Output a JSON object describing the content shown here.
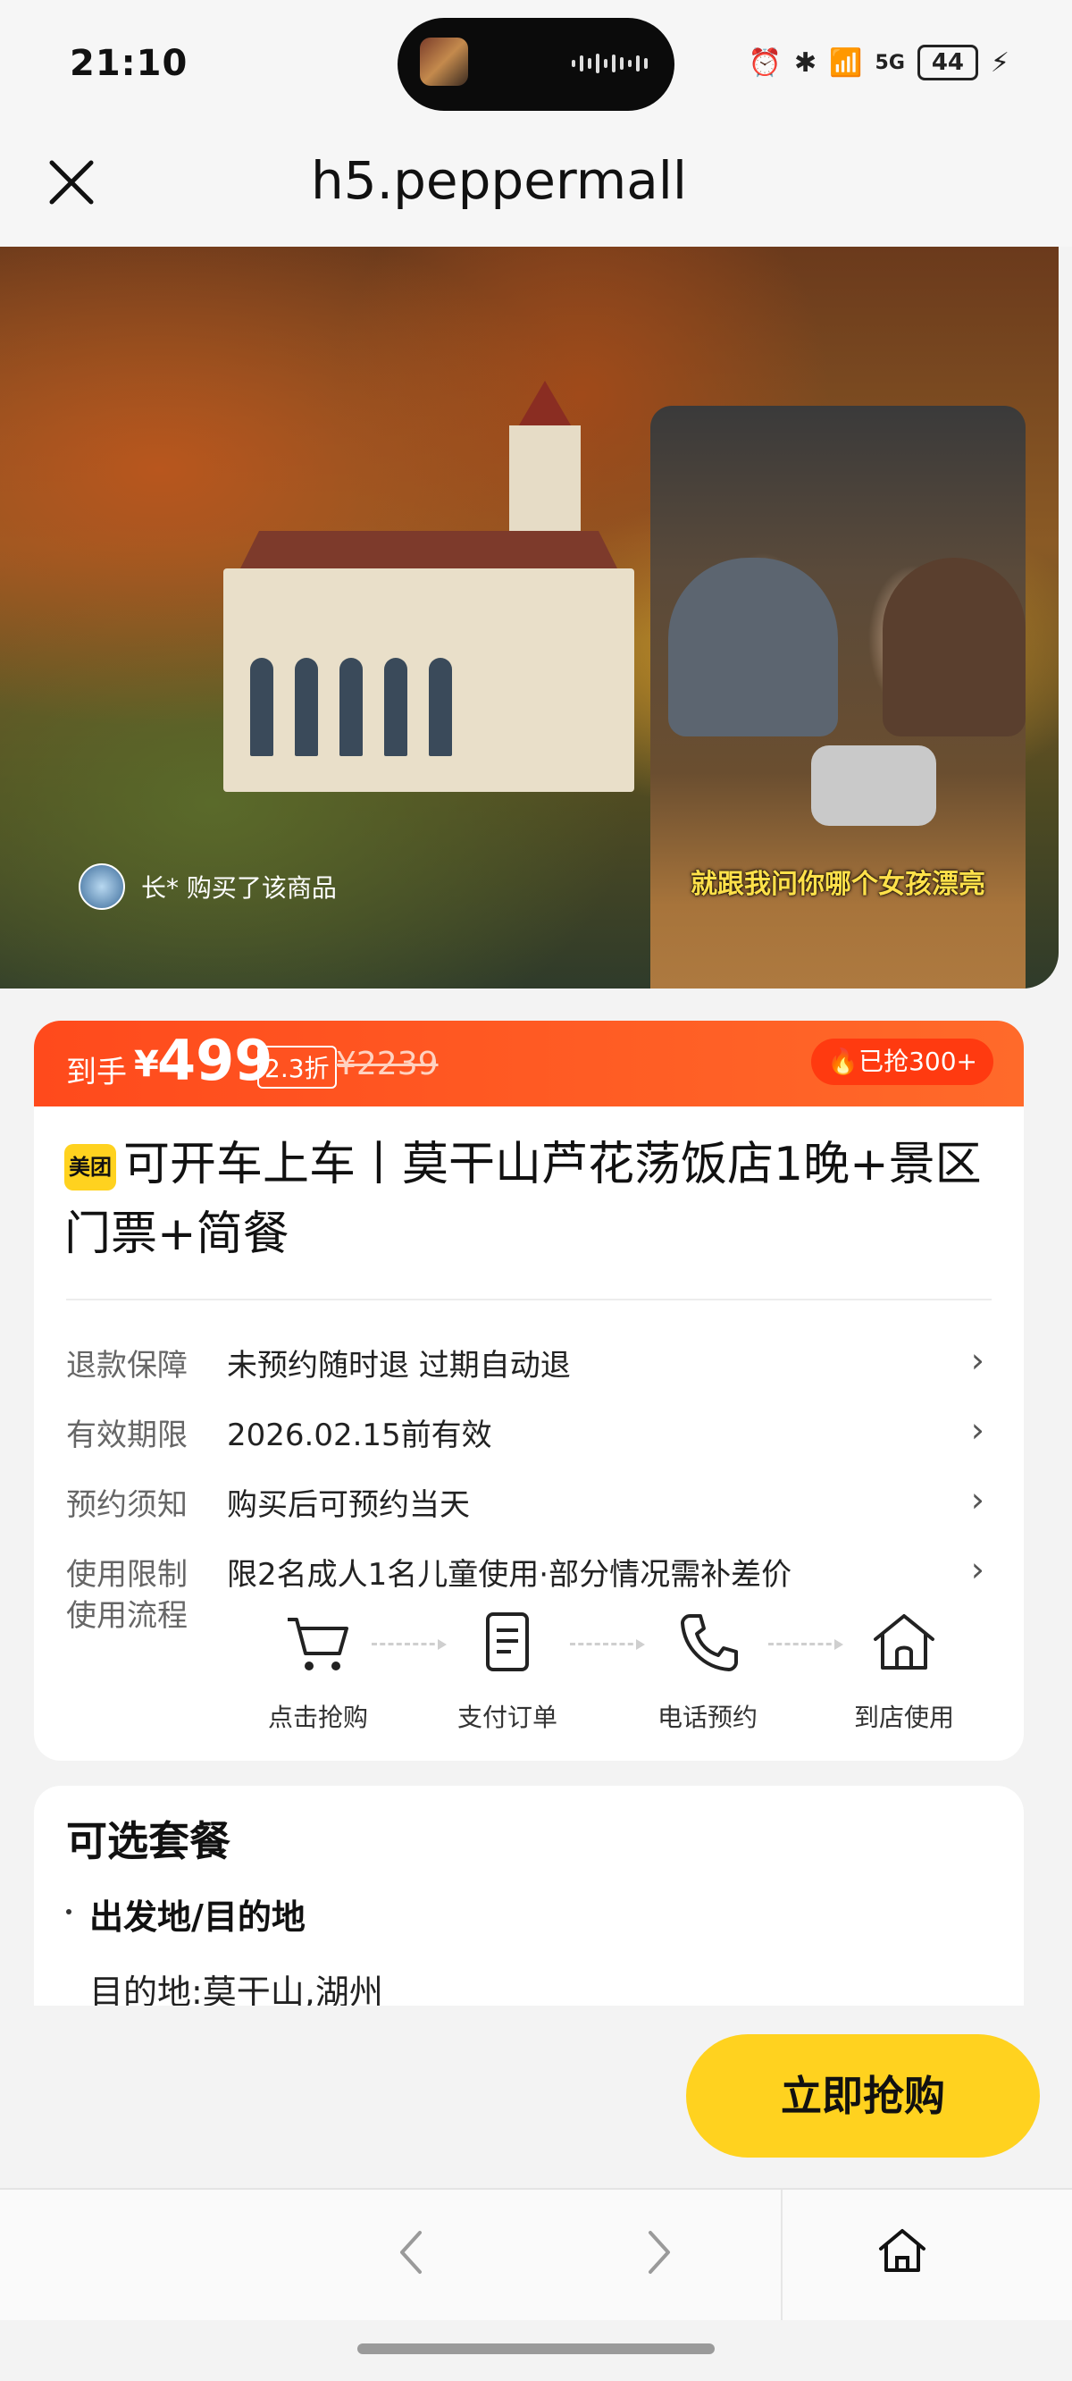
{
  "status_bar": {
    "time": "21:10",
    "network": "5G",
    "battery": "44"
  },
  "nav": {
    "url": "h5.peppermall"
  },
  "hero": {
    "buyer_text": "长* 购买了该商品",
    "pip_caption": "就跟我问你哪个女孩漂亮"
  },
  "price": {
    "label": "到手",
    "currency": "¥",
    "value": "499",
    "discount": "2.3折",
    "original": "¥2239",
    "sold": "已抢300+"
  },
  "product": {
    "badge": "美团",
    "title": "可开车上车丨莫干山芦花荡饭店1晚+景区门票+简餐"
  },
  "info_rows": [
    {
      "key": "退款保障",
      "value": "未预约随时退 过期自动退"
    },
    {
      "key": "有效期限",
      "value": "2026.02.15前有效"
    },
    {
      "key": "预约须知",
      "value": "购买后可预约当天"
    },
    {
      "key": "使用限制",
      "value": "限2名成人1名儿童使用·部分情况需补差价"
    }
  ],
  "flow": {
    "label": "使用流程",
    "steps": [
      {
        "label": "点击抢购",
        "icon": "cart-icon"
      },
      {
        "label": "支付订单",
        "icon": "document-icon"
      },
      {
        "label": "电话预约",
        "icon": "phone-icon"
      },
      {
        "label": "到店使用",
        "icon": "home-icon"
      }
    ]
  },
  "packages": {
    "title": "可选套餐",
    "subtitle": "出发地/目的地",
    "destination": "目的地:莫干山,湖州"
  },
  "cta": {
    "buy_label": "立即抢购"
  },
  "colors": {
    "accent": "#ff5722",
    "cta": "#ffd21f"
  }
}
